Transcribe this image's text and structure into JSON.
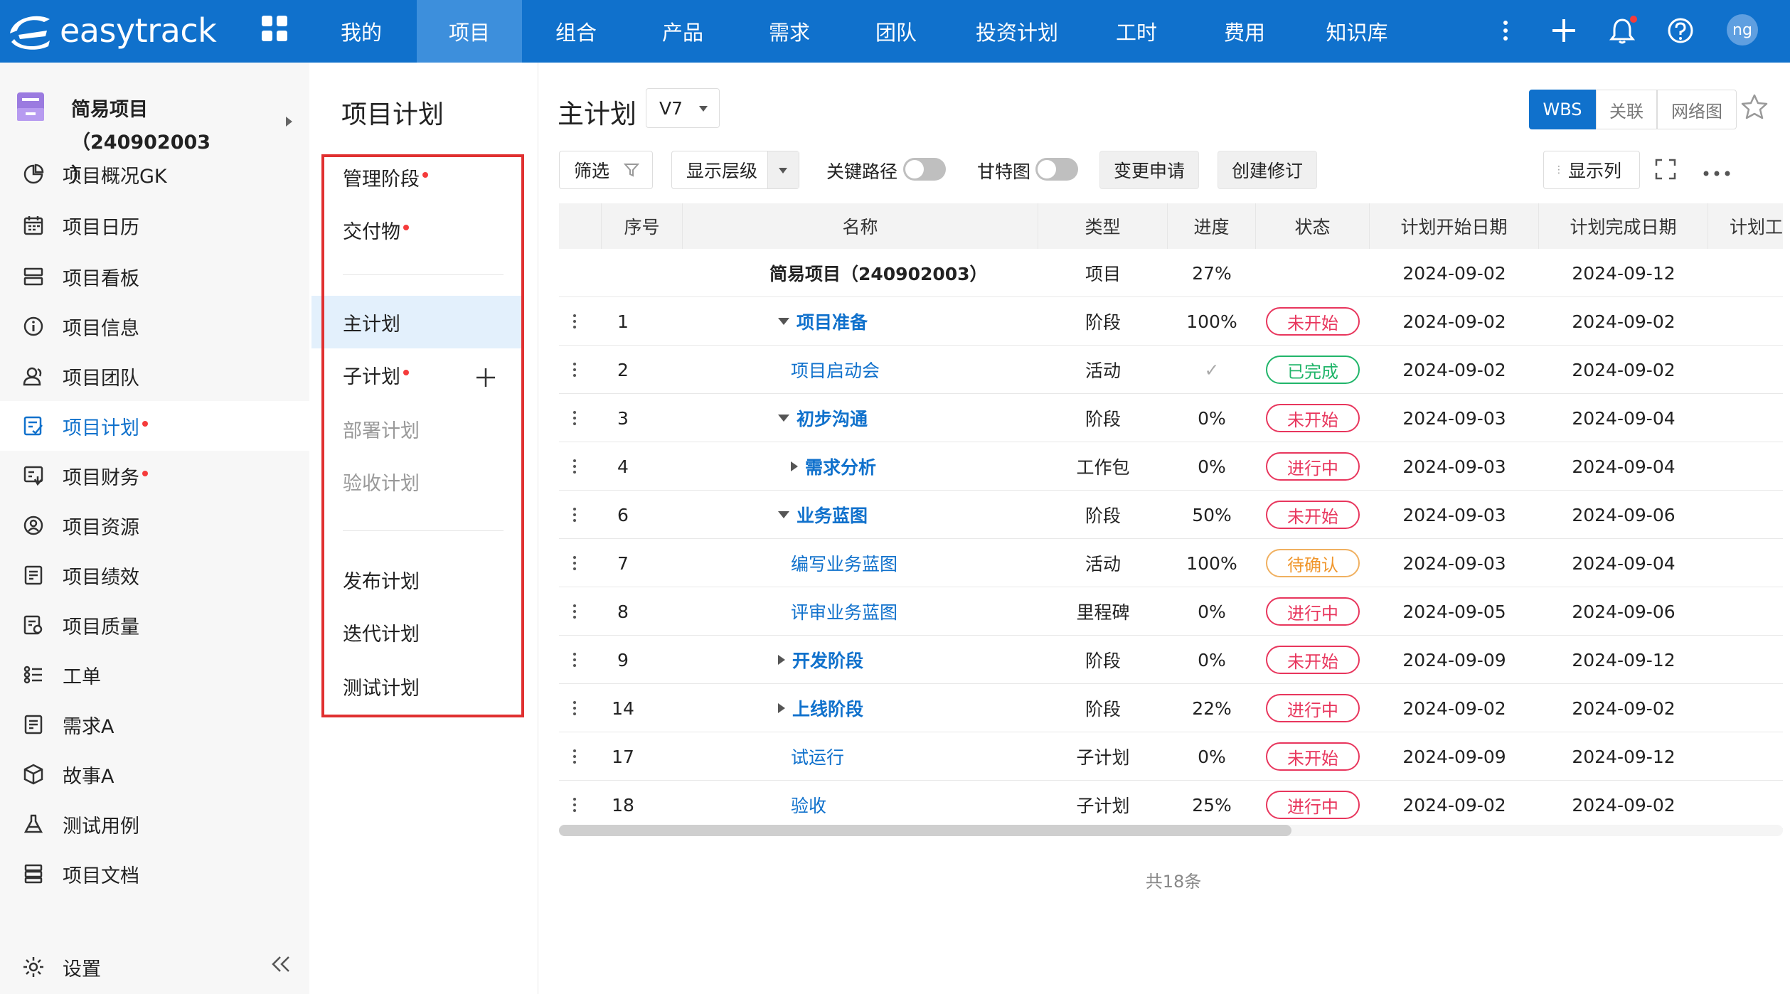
{
  "brand": {
    "name": "easytrack"
  },
  "topnav": {
    "items": [
      "我的",
      "项目",
      "组合",
      "产品",
      "需求",
      "团队",
      "投资计划",
      "工时",
      "费用",
      "知识库"
    ],
    "active_index": 1,
    "user_initials": "ng"
  },
  "sidebar": {
    "project_name": "简易项目（240902003",
    "project_name_cont": "）",
    "items": [
      {
        "label": "项目概况GK",
        "icon": "pie-chart-icon"
      },
      {
        "label": "项目日历",
        "icon": "calendar-icon"
      },
      {
        "label": "项目看板",
        "icon": "kanban-icon"
      },
      {
        "label": "项目信息",
        "icon": "info-icon"
      },
      {
        "label": "项目团队",
        "icon": "team-icon"
      },
      {
        "label": "项目计划",
        "icon": "plan-icon",
        "active": true,
        "dot": true
      },
      {
        "label": "项目财务",
        "icon": "finance-icon",
        "dot": true
      },
      {
        "label": "项目资源",
        "icon": "resource-icon"
      },
      {
        "label": "项目绩效",
        "icon": "performance-icon"
      },
      {
        "label": "项目质量",
        "icon": "quality-icon"
      },
      {
        "label": "工单",
        "icon": "ticket-icon"
      },
      {
        "label": "需求A",
        "icon": "requirement-icon"
      },
      {
        "label": "故事A",
        "icon": "story-icon"
      },
      {
        "label": "测试用例",
        "icon": "flask-icon"
      },
      {
        "label": "项目文档",
        "icon": "document-icon"
      }
    ],
    "settings_label": "设置"
  },
  "subnav": {
    "title": "项目计划",
    "items": [
      {
        "label": "管理阶段",
        "dot": true
      },
      {
        "label": "交付物",
        "dot": true
      },
      {
        "label": "主计划",
        "active": true
      },
      {
        "label": "子计划",
        "dot": true
      },
      {
        "label": "部署计划",
        "disabled": true
      },
      {
        "label": "验收计划",
        "disabled": true
      },
      {
        "label": "发布计划"
      },
      {
        "label": "迭代计划"
      },
      {
        "label": "测试计划"
      }
    ]
  },
  "main": {
    "title": "主计划",
    "version": "V7",
    "view_tabs": [
      "WBS",
      "关联",
      "网络图"
    ],
    "toolbar": {
      "filter": "筛选",
      "levels": "显示层级",
      "critical_path": "关键路径",
      "gantt": "甘特图",
      "change_request": "变更申请",
      "create_revision": "创建修订",
      "show_columns": "显示列"
    },
    "columns": [
      "序号",
      "名称",
      "类型",
      "进度",
      "状态",
      "计划开始日期",
      "计划完成日期",
      "计划工"
    ],
    "rows": [
      {
        "no": "",
        "name": "简易项目（240902003）",
        "type": "项目",
        "progress": "27%",
        "status": "",
        "start": "2024-09-02",
        "end": "2024-09-12",
        "level": 0,
        "style": "bold",
        "twisty": "none",
        "drag": false
      },
      {
        "no": "1",
        "name": "项目准备",
        "type": "阶段",
        "progress": "100%",
        "status": "未开始",
        "start": "2024-09-02",
        "end": "2024-09-02",
        "level": 1,
        "style": "bold-link",
        "twisty": "down",
        "drag": true
      },
      {
        "no": "2",
        "name": "项目启动会",
        "type": "活动",
        "progress": "✓",
        "status": "已完成",
        "start": "2024-09-02",
        "end": "2024-09-02",
        "level": 2,
        "style": "link",
        "twisty": "none",
        "drag": true
      },
      {
        "no": "3",
        "name": "初步沟通",
        "type": "阶段",
        "progress": "0%",
        "status": "未开始",
        "start": "2024-09-03",
        "end": "2024-09-04",
        "level": 1,
        "style": "bold-link",
        "twisty": "down",
        "drag": true
      },
      {
        "no": "4",
        "name": "需求分析",
        "type": "工作包",
        "progress": "0%",
        "status": "进行中",
        "start": "2024-09-03",
        "end": "2024-09-04",
        "level": 2,
        "style": "bold-link",
        "twisty": "right",
        "drag": true
      },
      {
        "no": "6",
        "name": "业务蓝图",
        "type": "阶段",
        "progress": "50%",
        "status": "未开始",
        "start": "2024-09-03",
        "end": "2024-09-06",
        "level": 1,
        "style": "bold-link",
        "twisty": "down",
        "drag": true
      },
      {
        "no": "7",
        "name": "编写业务蓝图",
        "type": "活动",
        "progress": "100%",
        "status": "待确认",
        "start": "2024-09-03",
        "end": "2024-09-04",
        "level": 2,
        "style": "link",
        "twisty": "none",
        "drag": true
      },
      {
        "no": "8",
        "name": "评审业务蓝图",
        "type": "里程碑",
        "progress": "0%",
        "status": "进行中",
        "start": "2024-09-05",
        "end": "2024-09-06",
        "level": 2,
        "style": "link",
        "twisty": "none",
        "drag": true
      },
      {
        "no": "9",
        "name": "开发阶段",
        "type": "阶段",
        "progress": "0%",
        "status": "未开始",
        "start": "2024-09-09",
        "end": "2024-09-12",
        "level": 1,
        "style": "bold-link",
        "twisty": "right",
        "drag": true
      },
      {
        "no": "14",
        "name": "上线阶段",
        "type": "阶段",
        "progress": "22%",
        "status": "进行中",
        "start": "2024-09-02",
        "end": "2024-09-02",
        "level": 1,
        "style": "bold-link",
        "twisty": "right",
        "drag": true
      },
      {
        "no": "17",
        "name": "试运行",
        "type": "子计划",
        "progress": "0%",
        "status": "未开始",
        "start": "2024-09-09",
        "end": "2024-09-12",
        "level": 1,
        "style": "link",
        "twisty": "none",
        "drag": true
      },
      {
        "no": "18",
        "name": "验收",
        "type": "子计划",
        "progress": "25%",
        "status": "进行中",
        "start": "2024-09-02",
        "end": "2024-09-02",
        "level": 1,
        "style": "link",
        "twisty": "none",
        "drag": true
      }
    ],
    "total": "共18条"
  },
  "colors": {
    "primary": "#1071cc",
    "status_red": "#e8365d",
    "status_green": "#21b56a",
    "status_orange": "#f0962c"
  }
}
